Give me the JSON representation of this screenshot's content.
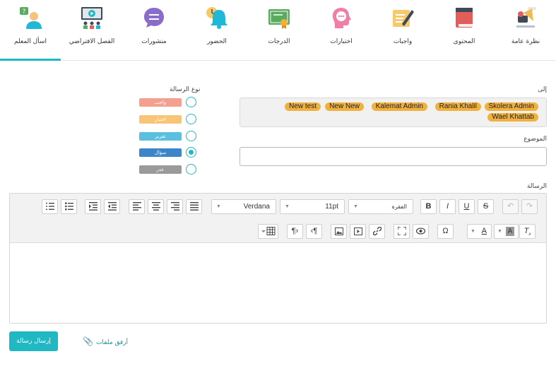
{
  "nav": {
    "items": [
      {
        "label": "نظرة عامة",
        "icon": "overview-icon"
      },
      {
        "label": "المحتوى",
        "icon": "book-icon"
      },
      {
        "label": "واجبات",
        "icon": "homework-icon"
      },
      {
        "label": "اختبارات",
        "icon": "quiz-icon"
      },
      {
        "label": "الدرجات",
        "icon": "certificate-icon"
      },
      {
        "label": "الحضور",
        "icon": "bell-clock-icon"
      },
      {
        "label": "منشورات",
        "icon": "chat-bubble-icon"
      },
      {
        "label": "الفصل الافتراضي",
        "icon": "virtual-class-icon"
      },
      {
        "label": "اسأل المعلم",
        "icon": "ask-teacher-icon"
      }
    ],
    "active_index": 8,
    "accent": "#1fb8c3"
  },
  "form": {
    "to_label": "إلى",
    "recipients": [
      "Skolera Admin",
      "Rania Khalil",
      "Kalemat Admin",
      "New New",
      "New test",
      "Wael Khattab"
    ],
    "subject_label": "الموضوع",
    "subject_value": "",
    "message_label": "الرسالة",
    "message_type_label": "نوع الرسالة",
    "message_types": [
      {
        "label": "واجب",
        "color": "#f5a08e",
        "selected": false
      },
      {
        "label": "اختبار",
        "color": "#f8c478",
        "selected": false
      },
      {
        "label": "تقرير",
        "color": "#5bc0de",
        "selected": false
      },
      {
        "label": "سؤال",
        "color": "#3a86c8",
        "selected": true
      },
      {
        "label": "عذر",
        "color": "#9a9a9a",
        "selected": false
      }
    ]
  },
  "editor": {
    "font_family": "Verdana",
    "font_size": "11pt",
    "paragraph": "الفقرة"
  },
  "actions": {
    "send_label": "إرسال رسالة",
    "attach_label": "أرفق ملفات"
  }
}
